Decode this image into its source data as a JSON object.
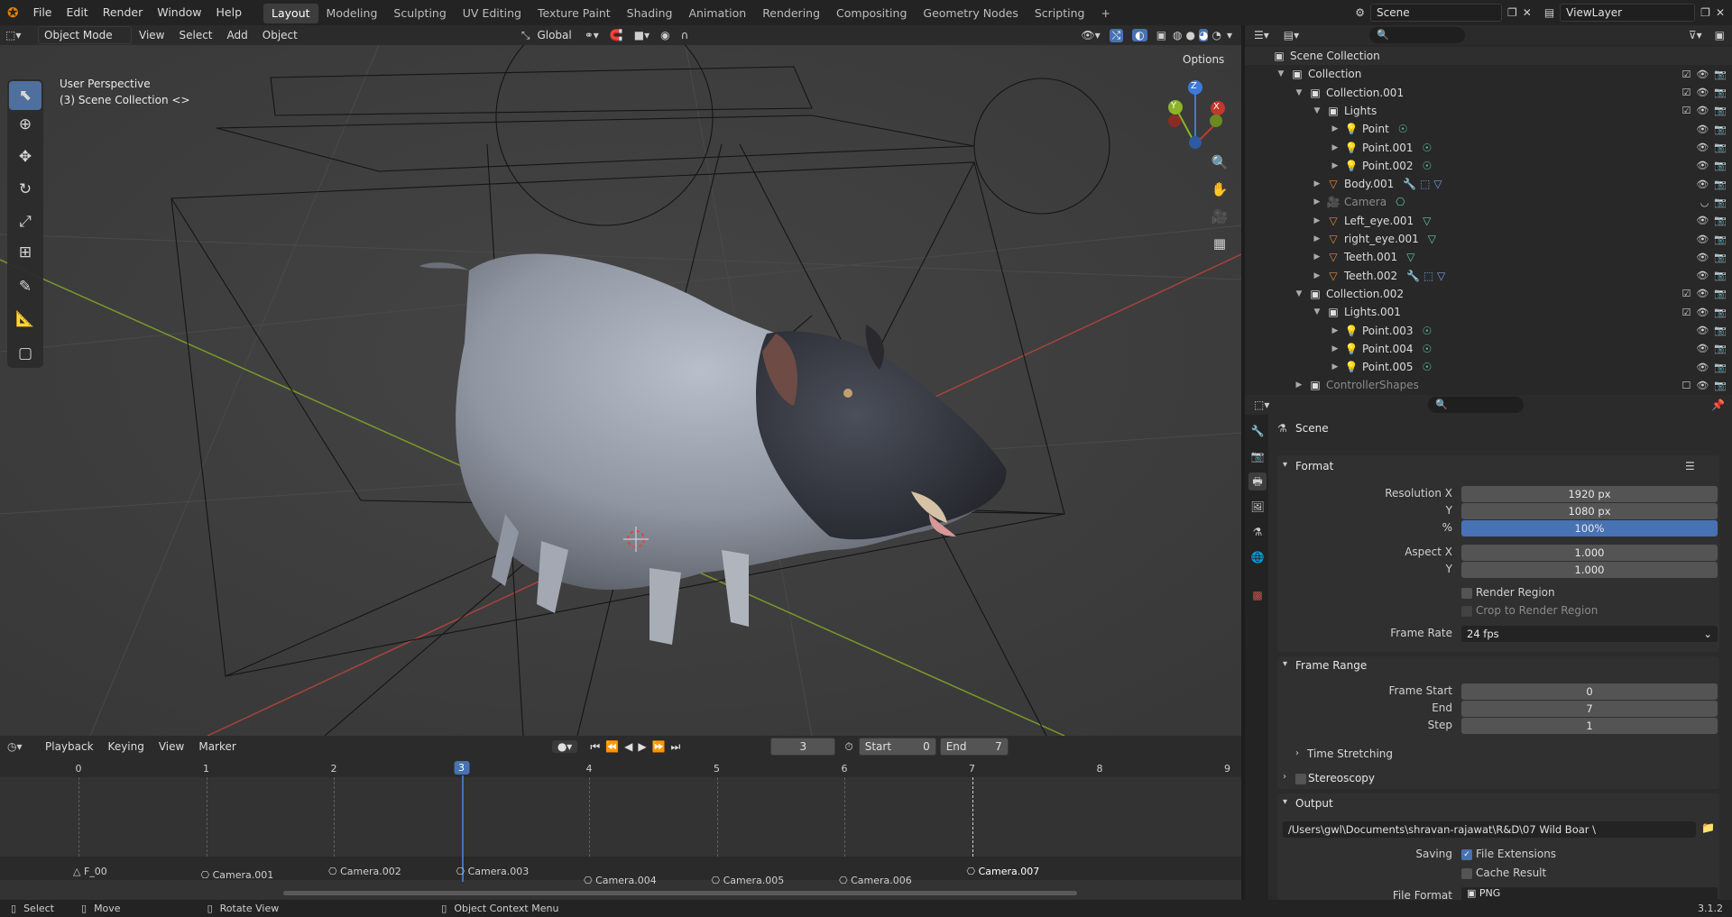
{
  "menu": {
    "items": [
      "File",
      "Edit",
      "Render",
      "Window",
      "Help"
    ],
    "workspaces": [
      "Layout",
      "Modeling",
      "Sculpting",
      "UV Editing",
      "Texture Paint",
      "Shading",
      "Animation",
      "Rendering",
      "Compositing",
      "Geometry Nodes",
      "Scripting"
    ],
    "active_workspace": "Layout",
    "add_tab": "+",
    "scene": "Scene",
    "view_layer": "ViewLayer"
  },
  "viewport": {
    "mode": "Object Mode",
    "menu_items": [
      "View",
      "Select",
      "Add",
      "Object"
    ],
    "transform_orientation": "Global",
    "options": "Options",
    "overlay_text_line1": "User Perspective",
    "overlay_text_line2": "(3) Scene Collection <>",
    "gizmo_axes": [
      "Z",
      "Y",
      "X"
    ]
  },
  "outliner": {
    "search_placeholder": "",
    "rows": [
      {
        "depth": 0,
        "label": "Scene Collection",
        "icon": "scene-collection-icon",
        "expand": false
      },
      {
        "depth": 1,
        "label": "Collection",
        "icon": "collection-icon",
        "expand": true
      },
      {
        "depth": 2,
        "label": "Collection.001",
        "icon": "collection-icon",
        "expand": true
      },
      {
        "depth": 3,
        "label": "Lights",
        "icon": "collection-icon",
        "expand": true
      },
      {
        "depth": 4,
        "label": "Point",
        "icon": "light-icon",
        "extra": "light-data"
      },
      {
        "depth": 4,
        "label": "Point.001",
        "icon": "light-icon",
        "extra": "light-data"
      },
      {
        "depth": 4,
        "label": "Point.002",
        "icon": "light-icon",
        "extra": "light-data"
      },
      {
        "depth": 3,
        "label": "Body.001",
        "icon": "mesh-icon",
        "extra": "modifiers"
      },
      {
        "depth": 3,
        "label": "Camera",
        "icon": "camera-icon",
        "extra": "camera-data",
        "muted": true
      },
      {
        "depth": 3,
        "label": "Left_eye.001",
        "icon": "mesh-icon",
        "extra": "mesh-data"
      },
      {
        "depth": 3,
        "label": "right_eye.001",
        "icon": "mesh-icon",
        "extra": "mesh-data"
      },
      {
        "depth": 3,
        "label": "Teeth.001",
        "icon": "mesh-icon",
        "extra": "mesh-data"
      },
      {
        "depth": 3,
        "label": "Teeth.002",
        "icon": "mesh-icon",
        "extra": "modifiers"
      },
      {
        "depth": 2,
        "label": "Collection.002",
        "icon": "collection-icon",
        "expand": true
      },
      {
        "depth": 3,
        "label": "Lights.001",
        "icon": "collection-icon",
        "expand": true
      },
      {
        "depth": 4,
        "label": "Point.003",
        "icon": "light-icon",
        "extra": "light-data"
      },
      {
        "depth": 4,
        "label": "Point.004",
        "icon": "light-icon",
        "extra": "light-data"
      },
      {
        "depth": 4,
        "label": "Point.005",
        "icon": "light-icon",
        "extra": "light-data"
      },
      {
        "depth": 2,
        "label": "ControllerShapes",
        "icon": "collection-icon",
        "muted": true
      }
    ]
  },
  "properties": {
    "context": "Scene",
    "format": {
      "title": "Format",
      "resolution_x_label": "Resolution X",
      "resolution_x": "1920 px",
      "resolution_y_label": "Y",
      "resolution_y": "1080 px",
      "percent_label": "%",
      "percent": "100%",
      "aspect_x_label": "Aspect X",
      "aspect_x": "1.000",
      "aspect_y_label": "Y",
      "aspect_y": "1.000",
      "render_region": "Render Region",
      "crop_region": "Crop to Render Region",
      "frame_rate_label": "Frame Rate",
      "frame_rate": "24 fps"
    },
    "frame_range": {
      "title": "Frame Range",
      "start_label": "Frame Start",
      "start": "0",
      "end_label": "End",
      "end": "7",
      "step_label": "Step",
      "step": "1",
      "time_stretching": "Time Stretching"
    },
    "stereoscopy": "Stereoscopy",
    "output": {
      "title": "Output",
      "path": "/Users\\gwl\\Documents\\shravan-rajawat\\R&D\\07 Wild Boar \\",
      "saving_label": "Saving",
      "file_extensions": "File Extensions",
      "cache_result": "Cache Result",
      "file_format_label": "File Format",
      "file_format": "PNG"
    }
  },
  "timeline": {
    "menus": [
      "Playback",
      "Keying",
      "View",
      "Marker"
    ],
    "current_frame": "3",
    "start_label": "Start",
    "start": "0",
    "end_label": "End",
    "end": "7",
    "frames": [
      "0",
      "1",
      "2",
      "3",
      "4",
      "5",
      "6",
      "7",
      "8",
      "9"
    ],
    "markers": [
      "F_00",
      "Camera.001",
      "Camera.002",
      "Camera.003",
      "Camera.004",
      "Camera.005",
      "Camera.006",
      "Camera.007"
    ]
  },
  "status": {
    "select": "Select",
    "move": "Move",
    "rotate": "Rotate View",
    "context_menu": "Object Context Menu",
    "version": "3.1.2"
  },
  "colors": {
    "accent": "#4772b3",
    "x_axis": "#c0392b",
    "y_axis": "#8cb32a",
    "z_axis": "#3c7ad8"
  }
}
